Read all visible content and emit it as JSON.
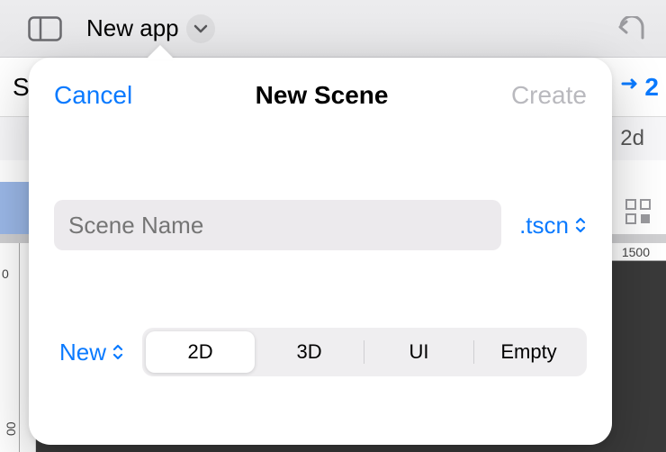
{
  "topbar": {
    "app_title": "New app"
  },
  "bg": {
    "left_letter": "S",
    "right_link": "2",
    "label_2d": "2d",
    "ruler_1500": "1500",
    "ruler_zero": "0",
    "ruler_500": "00"
  },
  "modal": {
    "cancel": "Cancel",
    "title": "New Scene",
    "create": "Create",
    "name_placeholder": "Scene Name",
    "extension": ".tscn",
    "new_label": "New",
    "segments": {
      "s0": "2D",
      "s1": "3D",
      "s2": "UI",
      "s3": "Empty"
    }
  }
}
